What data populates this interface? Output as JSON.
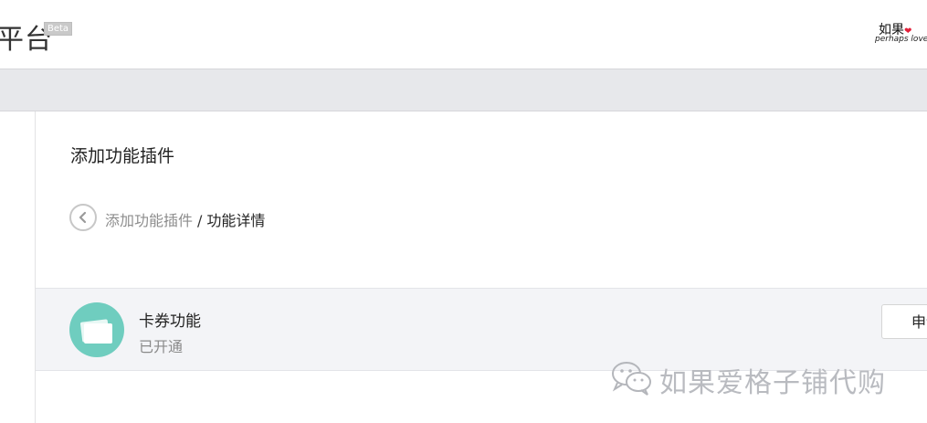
{
  "header": {
    "brand": "平台",
    "beta_badge": "Beta",
    "avatar": {
      "line1": "如果",
      "line2": "perhaps love"
    }
  },
  "main": {
    "page_title": "添加功能插件",
    "breadcrumb": {
      "parent": "添加功能插件",
      "separator": "/",
      "current": "功能详情"
    },
    "feature": {
      "name": "卡券功能",
      "status": "已开通",
      "action_label": "申请",
      "icon": "card-icon",
      "icon_color": "#6fcdbf"
    }
  },
  "watermark": {
    "text": "如果爱格子铺代购",
    "icon": "wechat-icon"
  }
}
